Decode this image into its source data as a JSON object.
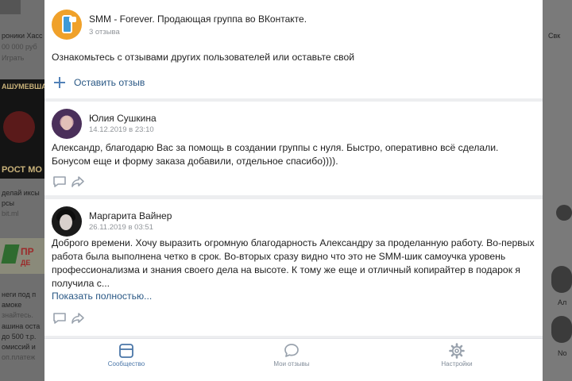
{
  "background": {
    "left_texts": [
      "роники Хасс",
      "00 000 руб",
      "Играть",
      "АШУМЕВША",
      "РОСТ МО",
      "делай иксы",
      "рсы",
      "bit.ml",
      "ПР",
      "ДЕ",
      "неги под п",
      "амоке",
      "знайтесь.",
      "ашина оста",
      "до 500 т.р.",
      "омиссий и",
      "оп.платеж"
    ],
    "right_texts": [
      "Свк",
      "Ал",
      "Nо"
    ]
  },
  "group": {
    "title": "SMM - Forever. Продающая группа во ВКонтакте.",
    "reviews_count": "3 отзыва",
    "intro": "Ознакомьтесь с отзывами других пользователей или оставьте свой",
    "add_review": "Оставить отзыв"
  },
  "reviews": [
    {
      "author": "Юлия Сушкина",
      "date": "14.12.2019 в 23:10",
      "text": "Александр, благодарю Вас за помощь в создании группы с нуля. Быстро, оперативно всё сделали. Бонусом еще и форму заказа добавили, отдельное спасибо))))."
    },
    {
      "author": "Маргарита Вайнер",
      "date": "26.11.2019 в 03:51",
      "text": "Доброго времени. Хочу выразить огромную благодарность Александру за проделанную работу. Во-первых работа была выполнена четко в срок. Во-вторых сразу видно что это не SMM-шик самоучка уровень профессионализма и знания своего дела на высоте. К тому же еще и отличный копирайтер в подарок я получила с...",
      "show_more": "Показать полностью..."
    }
  ],
  "tabs": [
    {
      "label": "Сообщество",
      "icon": "community-icon",
      "active": true
    },
    {
      "label": "Мои отзывы",
      "icon": "chat-bubble-icon",
      "active": false
    },
    {
      "label": "Настройки",
      "icon": "gear-icon",
      "active": false
    }
  ],
  "colors": {
    "link": "#2a5885",
    "accent": "#5181b8",
    "active_tab": "#4a76a8",
    "muted": "#909499"
  }
}
